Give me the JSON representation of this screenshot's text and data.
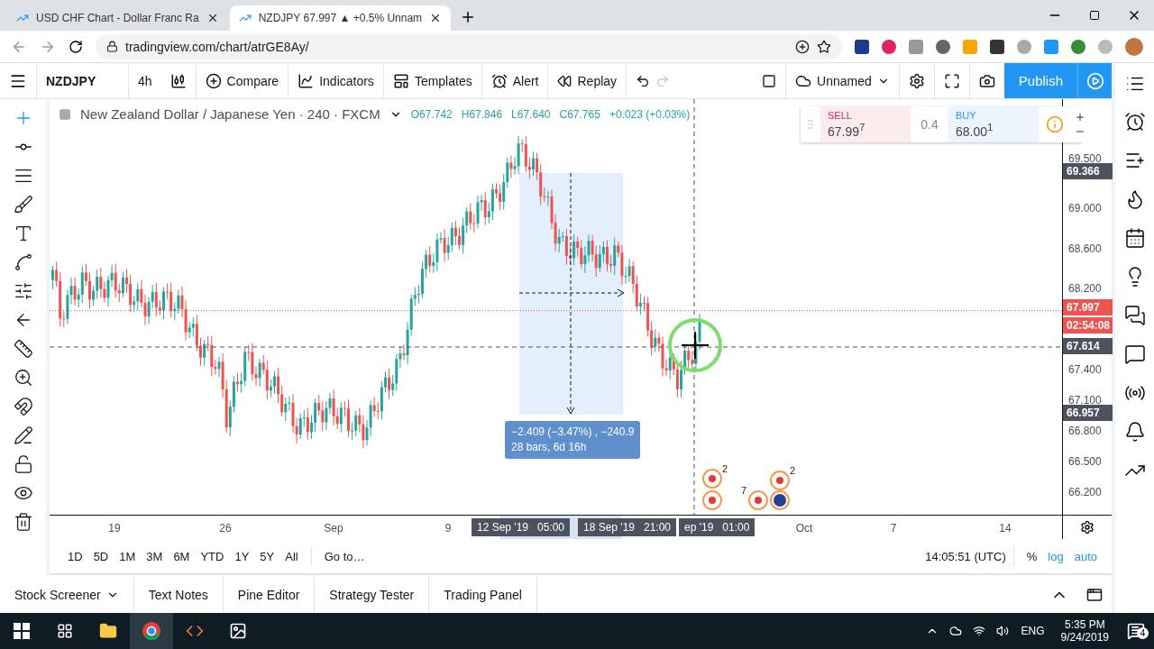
{
  "browser": {
    "tabs": [
      {
        "title": "USD CHF Chart - Dollar Franc Ra",
        "selected": false
      },
      {
        "title": "NZDJPY 67.997 ▲ +0.5% Unnam",
        "selected": true
      }
    ],
    "url": "tradingview.com/chart/atrGE8Ay/"
  },
  "toolbar": {
    "symbol": "NZDJPY",
    "interval": "4h",
    "buttons": [
      {
        "kind": "compare",
        "label": "Compare"
      },
      {
        "kind": "indicators",
        "label": "Indicators"
      },
      {
        "kind": "templates",
        "label": "Templates"
      },
      {
        "kind": "alert",
        "label": "Alert"
      },
      {
        "kind": "replay",
        "label": "Replay"
      }
    ],
    "layout_name": "Unnamed",
    "publish": "Publish"
  },
  "left_tools": [
    {
      "kind": "cursor",
      "selected": true
    },
    {
      "kind": "trendline",
      "selected": false
    },
    {
      "kind": "fib",
      "selected": false
    },
    {
      "kind": "brush",
      "selected": false
    },
    {
      "kind": "text",
      "selected": false
    },
    {
      "kind": "pattern",
      "selected": false
    },
    {
      "kind": "forecast",
      "selected": false
    },
    {
      "kind": "back",
      "selected": false
    },
    {
      "kind": "ruler",
      "selected": false
    },
    {
      "kind": "zoom",
      "selected": false
    },
    {
      "kind": "magnet",
      "selected": false
    },
    {
      "kind": "lockdraw",
      "selected": false
    },
    {
      "kind": "lock",
      "selected": false
    },
    {
      "kind": "eye",
      "selected": false
    },
    {
      "kind": "trash",
      "selected": false
    }
  ],
  "legend": {
    "title": "New Zealand Dollar / Japanese Yen · 240 · FXCM",
    "ohlc": [
      {
        "label": "O",
        "value": "67.742"
      },
      {
        "label": "H",
        "value": "67.846"
      },
      {
        "label": "L",
        "value": "67.640"
      },
      {
        "label": "C",
        "value": "67.765"
      }
    ],
    "change": "+0.023 (+0.03%)"
  },
  "trade_widget": {
    "sell_label": "SELL",
    "sell_price": "67.99$^{7}$",
    "spread": "0.4",
    "buy_label": "BUY",
    "buy_price": "68.00$^{1}$"
  },
  "price_axis": {
    "ticks": [
      "69.500",
      "69.000",
      "68.600",
      "68.200",
      "67.400",
      "67.100",
      "66.800",
      "66.500",
      "66.200"
    ],
    "markers": [
      {
        "kind": "high",
        "label": "69.366"
      },
      {
        "kind": "last",
        "label": "67.997",
        "countdown": "02:54:08"
      },
      {
        "kind": "crosshair",
        "label": "67.614"
      },
      {
        "kind": "low",
        "label": "66.957"
      }
    ]
  },
  "measurement": {
    "lines": [
      "−2.409 (−3.47%) , −240.9",
      "28 bars, 6d 16h"
    ]
  },
  "events": [
    {
      "count": "2"
    },
    {
      "count": "7"
    },
    {
      "count": "2"
    }
  ],
  "time_axis": {
    "ticks": [
      "19",
      "26",
      "Sep",
      "9",
      "Oct",
      "7",
      "14"
    ],
    "highlights": [
      {
        "date": "12 Sep '19",
        "time": "05:00"
      },
      {
        "date": "18 Sep '19",
        "time": "21:00"
      },
      {
        "date": "ep '19",
        "time": "01:00"
      }
    ]
  },
  "ranges": [
    "1D",
    "5D",
    "1M",
    "3M",
    "6M",
    "YTD",
    "1Y",
    "5Y",
    "All"
  ],
  "goto": "Go to…",
  "clock": "14:05:51 (UTC)",
  "scale_options": [
    {
      "label": "%",
      "on": false
    },
    {
      "label": "log",
      "on": true
    },
    {
      "label": "auto",
      "on": true
    }
  ],
  "bottom_tabs": [
    "Stock Screener",
    "Text Notes",
    "Pine Editor",
    "Strategy Tester",
    "Trading Panel"
  ],
  "taskbar": {
    "language": "ENG",
    "time": "5:35 PM",
    "date": "9/24/2019",
    "notifications": "4"
  }
}
